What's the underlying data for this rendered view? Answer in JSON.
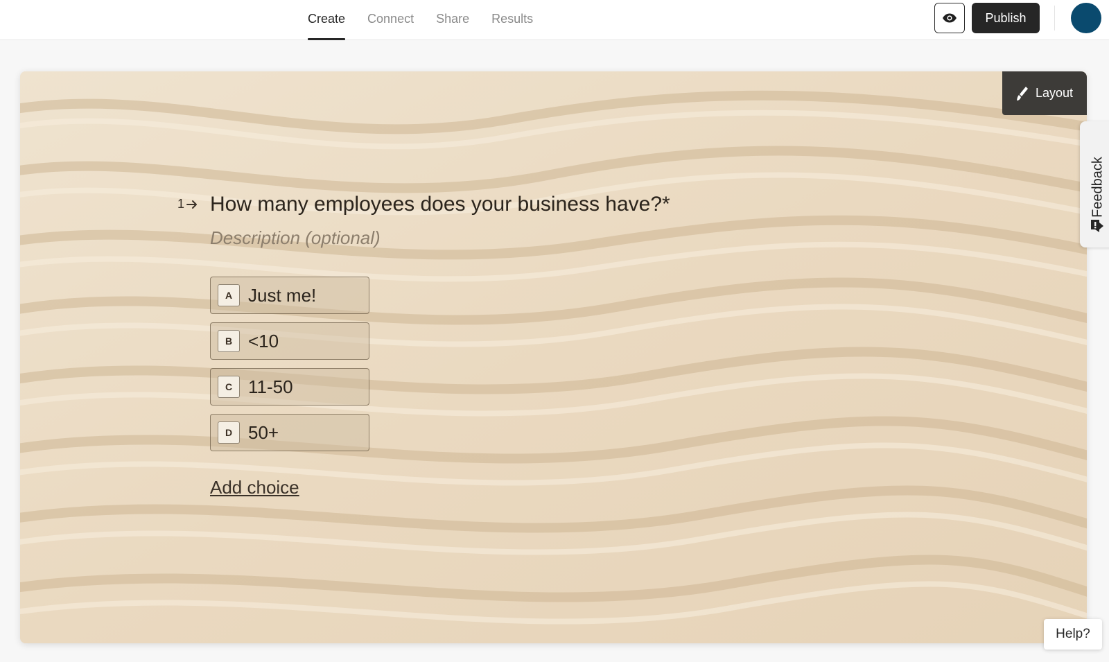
{
  "nav": {
    "tabs": [
      {
        "label": "Create",
        "active": true
      },
      {
        "label": "Connect",
        "active": false
      },
      {
        "label": "Share",
        "active": false
      },
      {
        "label": "Results",
        "active": false
      }
    ],
    "preview_icon": "eye-icon",
    "publish_label": "Publish",
    "avatar_color": "#0a4a6e"
  },
  "canvas": {
    "layout_label": "Layout",
    "layout_icon": "brush-icon",
    "background": "sand-dunes-image"
  },
  "question": {
    "number": "1",
    "number_icon": "arrow-right-icon",
    "title": "How many employees does your business have?*",
    "description_placeholder": "Description (optional)",
    "choices": [
      {
        "key": "A",
        "label": "Just me!"
      },
      {
        "key": "B",
        "label": "<10"
      },
      {
        "key": "C",
        "label": "11-50"
      },
      {
        "key": "D",
        "label": "50+"
      }
    ],
    "add_choice_label": "Add choice"
  },
  "feedback": {
    "label": "Feedback",
    "icon": "feedback-icon"
  },
  "help": {
    "label": "Help?"
  },
  "colors": {
    "dark": "#262626",
    "sand": "#e9dcc6",
    "avatar": "#0a4a6e"
  }
}
